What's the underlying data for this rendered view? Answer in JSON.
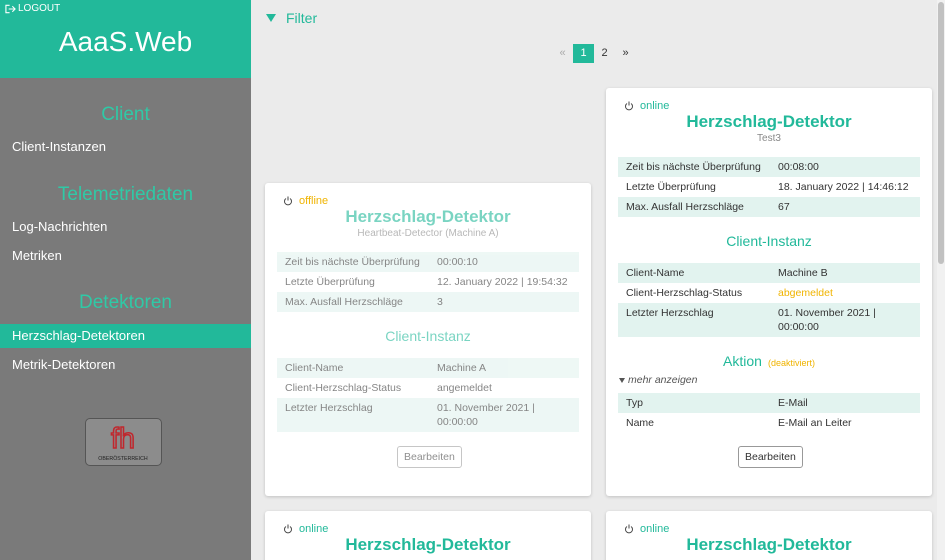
{
  "sidebar": {
    "logout": "LOGOUT",
    "app_title": "AaaS.Web",
    "sections": {
      "client": "Client",
      "telemetry": "Telemetriedaten",
      "detectors": "Detektoren"
    },
    "items": {
      "client_instances": "Client-Instanzen",
      "log_messages": "Log-Nachrichten",
      "metrics": "Metriken",
      "heartbeat_detectors": "Herzschlag-Detektoren",
      "metric_detectors": "Metrik-Detektoren"
    },
    "logo": {
      "letters": "fh",
      "subtitle": "OBERÖSTERREICH"
    }
  },
  "main": {
    "filter_label": "Filter",
    "pagination": {
      "prev": "«",
      "pages": [
        "1",
        "2"
      ],
      "next": "»",
      "current": "1"
    }
  },
  "cards": [
    {
      "status": "offline",
      "title": "Herzschlag-Detektor",
      "subtitle": "Heartbeat-Detector (Machine A)",
      "info": [
        {
          "k": "Zeit bis nächste Überprüfung",
          "v": "00:00:10"
        },
        {
          "k": "Letzte Überprüfung",
          "v": "12. January 2022 | 19:54:32"
        },
        {
          "k": "Max. Ausfall Herzschläge",
          "v": "3"
        }
      ],
      "client_section": "Client-Instanz",
      "client": [
        {
          "k": "Client-Name",
          "v": "Machine A"
        },
        {
          "k": "Client-Herzschlag-Status",
          "v": "angemeldet"
        },
        {
          "k": "Letzter Herzschlag",
          "v": "01. November 2021 |",
          "v2": "00:00:00"
        }
      ],
      "button": "Bearbeiten"
    },
    {
      "status": "online",
      "title": "Herzschlag-Detektor",
      "subtitle": "Test3",
      "info": [
        {
          "k": "Zeit bis nächste Überprüfung",
          "v": "00:08:00"
        },
        {
          "k": "Letzte Überprüfung",
          "v": "18. January 2022 | 14:46:12"
        },
        {
          "k": "Max. Ausfall Herzschläge",
          "v": "67"
        }
      ],
      "client_section": "Client-Instanz",
      "client": [
        {
          "k": "Client-Name",
          "v": "Machine B"
        },
        {
          "k": "Client-Herzschlag-Status",
          "v": "abgemeldet"
        },
        {
          "k": "Letzter Herzschlag",
          "v": "01. November 2021 |",
          "v2": "00:00:00"
        }
      ],
      "action_section": "Aktion",
      "action_tag": "(deaktiviert)",
      "more_label": "mehr anzeigen",
      "action": [
        {
          "k": "Typ",
          "v": "E-Mail"
        },
        {
          "k": "Name",
          "v": "E-Mail an Leiter"
        }
      ],
      "button": "Bearbeiten"
    },
    {
      "status": "online",
      "title": "Herzschlag-Detektor"
    },
    {
      "status": "online",
      "title": "Herzschlag-Detektor"
    }
  ],
  "colors": {
    "accent": "#22b99a",
    "warning": "#f0b400",
    "sidebar": "#7a7a7a",
    "background": "#ebebeb"
  }
}
